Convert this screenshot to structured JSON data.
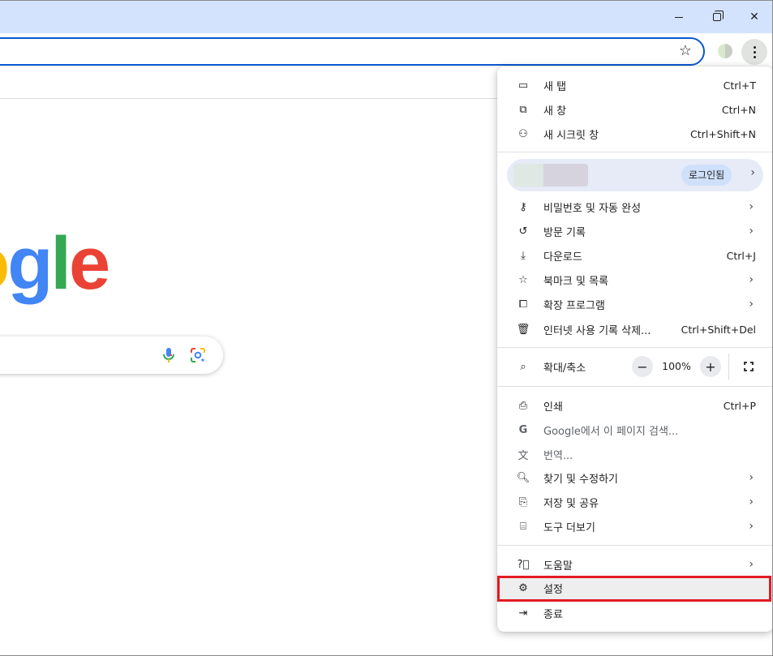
{
  "window": {
    "minimize_label": "–",
    "close_label": "✕"
  },
  "logo": {
    "g1": "o",
    "g2": "g",
    "g3": "l",
    "g4": "e"
  },
  "menu": {
    "items_top": [
      {
        "label": "새 탭",
        "shortcut": "Ctrl+T",
        "icon": "new-tab-icon"
      },
      {
        "label": "새 창",
        "shortcut": "Ctrl+N",
        "icon": "new-window-icon"
      },
      {
        "label": "새 시크릿 창",
        "shortcut": "Ctrl+Shift+N",
        "icon": "incognito-icon"
      }
    ],
    "profile": {
      "signin_label": "로그인됨"
    },
    "items_mid": [
      {
        "label": "비밀번호 및 자동 완성",
        "icon": "key-icon"
      },
      {
        "label": "방문 기록",
        "icon": "history-icon"
      },
      {
        "label": "다운로드",
        "shortcut": "Ctrl+J",
        "icon": "download-icon"
      },
      {
        "label": "북마크 및 목록",
        "icon": "star-icon"
      },
      {
        "label": "확장 프로그램",
        "icon": "puzzle-icon"
      },
      {
        "label": "인터넷 사용 기록 삭제...",
        "shortcut": "Ctrl+Shift+Del",
        "icon": "trash-icon"
      }
    ],
    "zoom": {
      "label": "확대/축소",
      "value": "100%",
      "minus": "−",
      "plus": "+"
    },
    "items_tools": [
      {
        "label": "인쇄",
        "shortcut": "Ctrl+P",
        "icon": "print-icon"
      },
      {
        "label": "Google에서 이 페이지 검색...",
        "icon": "google-g-icon"
      },
      {
        "label": "번역...",
        "icon": "translate-icon"
      },
      {
        "label": "찾기 및 수정하기",
        "icon": "find-icon"
      },
      {
        "label": "저장 및 공유",
        "icon": "save-share-icon"
      },
      {
        "label": "도구 더보기",
        "icon": "toolbox-icon"
      }
    ],
    "items_bottom": [
      {
        "label": "도움말",
        "icon": "help-icon"
      },
      {
        "label": "설정",
        "icon": "gear-icon"
      },
      {
        "label": "종료",
        "icon": "exit-icon"
      }
    ]
  },
  "colors": {
    "accent": "#0b57d0",
    "highlight": "#e31b23",
    "titlebar": "#d3e3fd"
  }
}
